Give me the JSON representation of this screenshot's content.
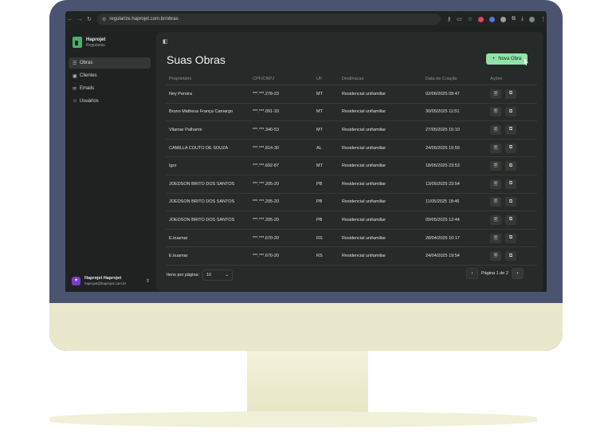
{
  "browser": {
    "url": "regularize.haprojet.com.br/obras"
  },
  "brand": {
    "name": "Haprojet",
    "sub": "Regularize"
  },
  "sidebar": {
    "items": [
      {
        "label": "Obras",
        "icon": "list-icon",
        "active": true
      },
      {
        "label": "Clientes",
        "icon": "briefcase-icon",
        "active": false
      },
      {
        "label": "Emails",
        "icon": "mail-icon",
        "active": false
      },
      {
        "label": "Usuários",
        "icon": "users-icon",
        "active": false
      }
    ]
  },
  "user": {
    "name": "Haprojet Haprojet",
    "email": "haprojet@haprojet.com.br"
  },
  "main": {
    "title": "Suas Obras",
    "new_button": "Nova Obra",
    "columns": [
      "Proprietário",
      "CPF/CNPJ",
      "UF",
      "Destinacao",
      "Data de Criação",
      "Ações"
    ],
    "rows": [
      {
        "owner": "Ney Pereira",
        "cpf": "***.***.278-23",
        "uf": "MT",
        "dest": "Residencial unifamiliar",
        "date": "02/06/2025 09:47"
      },
      {
        "owner": "Bruno Matheus França Camargo",
        "cpf": "***.***.091-33",
        "uf": "MT",
        "dest": "Residencial unifamiliar",
        "date": "30/05/2025 11:51"
      },
      {
        "owner": "Vilamar Palharini",
        "cpf": "***.***.340-53",
        "uf": "MT",
        "dest": "Residencial unifamiliar",
        "date": "27/05/2025 15:10"
      },
      {
        "owner": "CAMILLA COUTO DE SOUZA",
        "cpf": "***.***.814-30",
        "uf": "AL",
        "dest": "Residencial unifamiliar",
        "date": "24/05/2025 15:59"
      },
      {
        "owner": "Igor",
        "cpf": "***.***.602-87",
        "uf": "MT",
        "dest": "Residencial unifamiliar",
        "date": "18/05/2025 23:53"
      },
      {
        "owner": "JOEDSON BRITO DOS SANTOS",
        "cpf": "***.***.205-20",
        "uf": "PB",
        "dest": "Residencial unifamiliar",
        "date": "13/05/2025 23:54"
      },
      {
        "owner": "JOEDSON BRITO DOS SANTOS",
        "cpf": "***.***.205-20",
        "uf": "PB",
        "dest": "Residencial unifamiliar",
        "date": "11/05/2025 18:46"
      },
      {
        "owner": "JOEDSON BRITO DOS SANTOS",
        "cpf": "***.***.205-20",
        "uf": "PB",
        "dest": "Residencial unifamiliar",
        "date": "09/05/2025 12:44"
      },
      {
        "owner": "E.kuamar",
        "cpf": "***.***.670-20",
        "uf": "RS",
        "dest": "Residencial unifamiliar",
        "date": "28/04/2025 10:17"
      },
      {
        "owner": "E.kuamar",
        "cpf": "***.***.670-20",
        "uf": "RS",
        "dest": "Residencial unifamiliar",
        "date": "24/04/2025 19:54"
      }
    ]
  },
  "pagination": {
    "per_page_label": "Itens por página:",
    "per_page_value": "10",
    "page_text": "Página 1 de 2"
  },
  "colors": {
    "accent": "#8fe3a8",
    "background": "#1f2220",
    "frame": "#4a5470"
  }
}
